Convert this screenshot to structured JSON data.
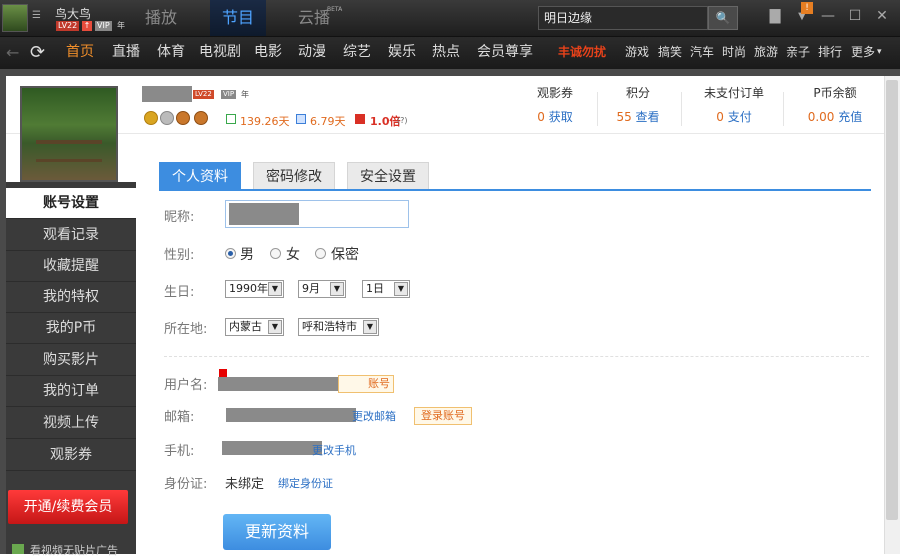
{
  "topbar": {
    "username": "鸟大鸟",
    "level_badge": "LV22",
    "vip_badge": "VIP",
    "year_mark": "年",
    "tabs": [
      "播放",
      "节目",
      "云播"
    ],
    "beta": "BETA",
    "search_value": "明日边缘",
    "notification_count": "!",
    "icons": [
      "avatar-icon",
      "search-icon",
      "message-icon",
      "dropdown-icon",
      "minimize-icon",
      "maximize-icon",
      "close-icon"
    ]
  },
  "nav": {
    "items": [
      "首页",
      "直播",
      "体育",
      "电视剧",
      "电影",
      "动漫",
      "综艺",
      "娱乐",
      "热点",
      "会员尊享",
      "丰诚勿扰",
      "游戏",
      "搞笑",
      "汽车",
      "时尚",
      "旅游",
      "亲子",
      "排行",
      "更多"
    ],
    "colors": {
      "active": "#f08e2a",
      "promo": "#e8421a"
    }
  },
  "header": {
    "lv": "LV22",
    "vip": "VIP",
    "nian": "年",
    "stat_days": "139.26天",
    "stat_days2": "6.79天",
    "stat_multiplier": "1.0倍",
    "stat_help": "(?)",
    "cols": [
      {
        "label": "观影券",
        "value": "0",
        "link": "获取"
      },
      {
        "label": "积分",
        "value": "55",
        "link": "查看"
      },
      {
        "label": "未支付订单",
        "value": "0",
        "link": "支付"
      },
      {
        "label": "P币余额",
        "value": "0.00",
        "link": "充值"
      }
    ]
  },
  "sidebar": {
    "items": [
      "账号设置",
      "观看记录",
      "收藏提醒",
      "我的特权",
      "我的P币",
      "购买影片",
      "我的订单",
      "视频上传",
      "观影券"
    ],
    "vip_button": "开通/续费会员",
    "ad_text": "看视频无贴片广告"
  },
  "tabs": [
    "个人资料",
    "密码修改",
    "安全设置"
  ],
  "form": {
    "nickname_label": "昵称:",
    "gender_label": "性别:",
    "gender_options": [
      "男",
      "女",
      "保密"
    ],
    "gender_selected": "男",
    "birthday_label": "生日:",
    "birthday": {
      "year": "1990年",
      "month": "9月",
      "day": "1日"
    },
    "location_label": "所在地:",
    "location": {
      "province": "内蒙古",
      "city": "呼和浩特市"
    },
    "username_label": "用户名:",
    "username_tag": "账号",
    "email_label": "邮箱:",
    "email_link": "更改邮箱",
    "email_tag": "登录账号",
    "phone_label": "手机:",
    "phone_link": "更改手机",
    "id_label": "身份证:",
    "id_value": "未绑定",
    "id_link": "绑定身份证",
    "save_button": "更新资料"
  }
}
